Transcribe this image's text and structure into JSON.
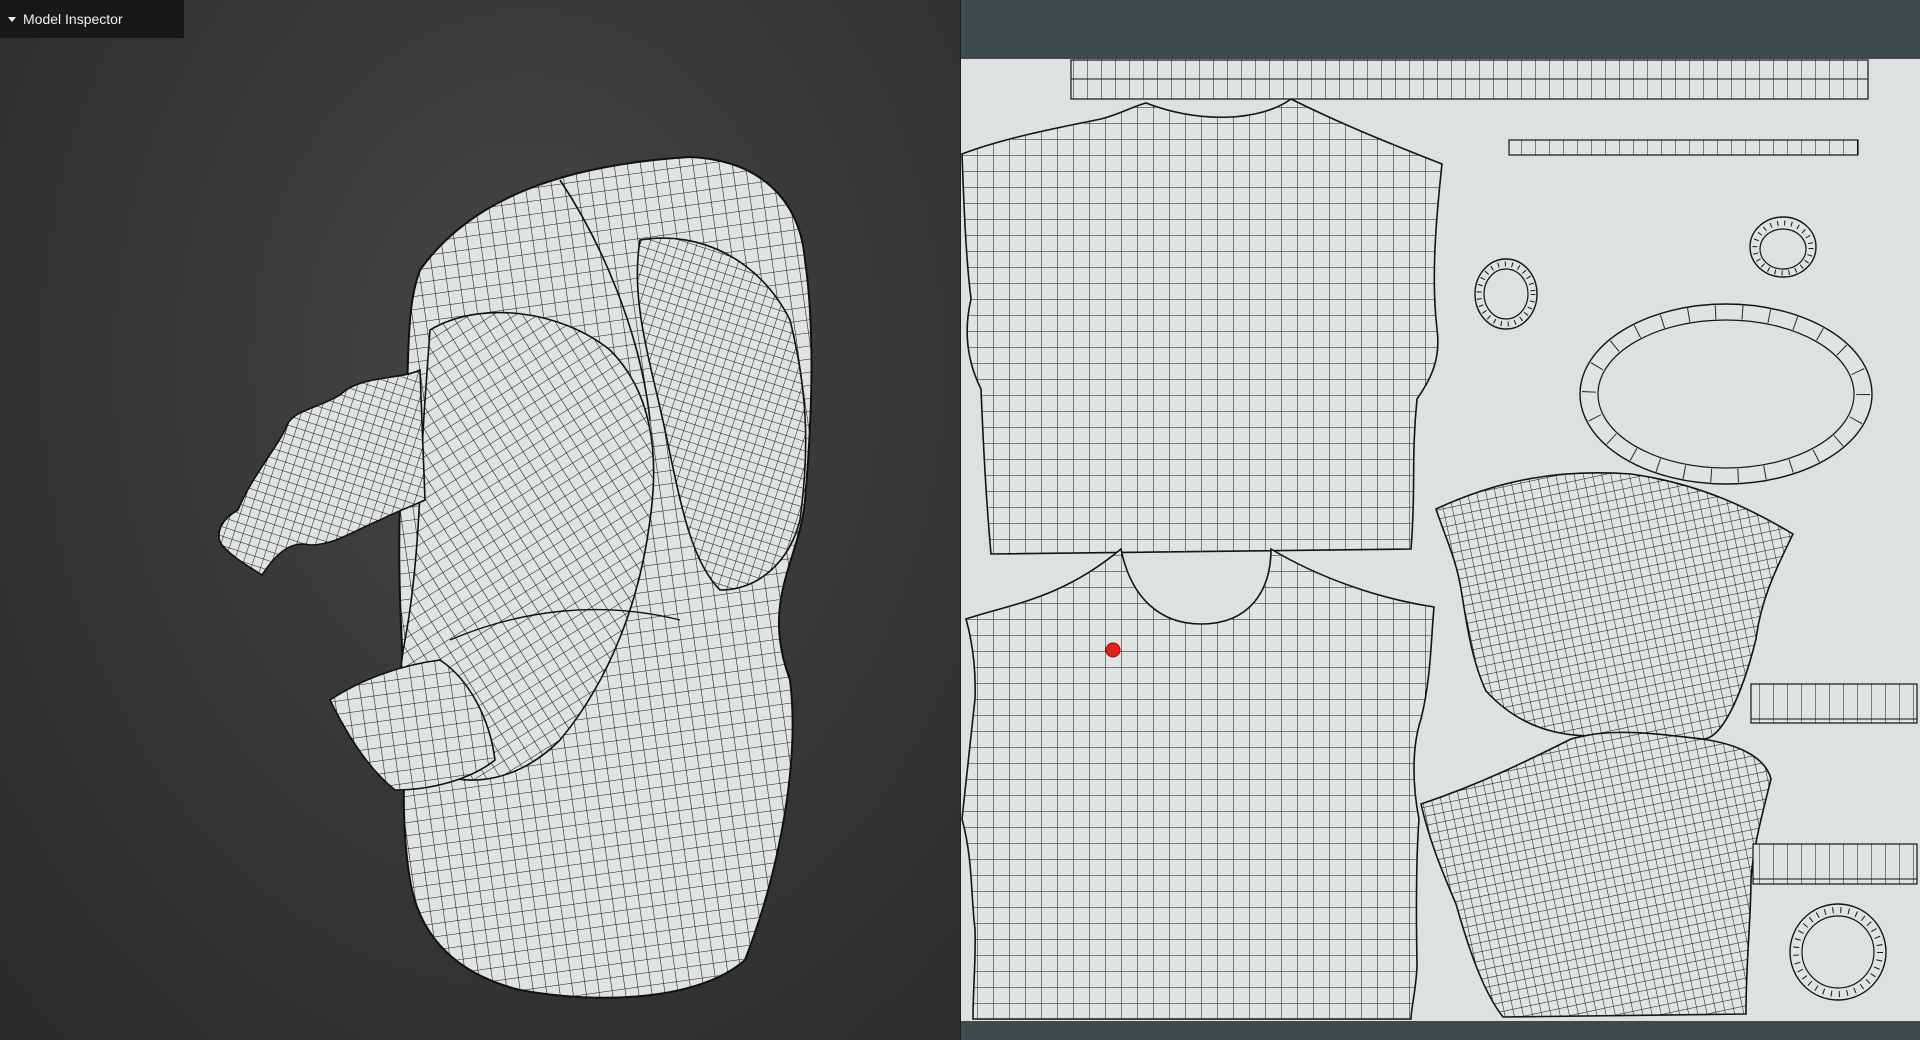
{
  "app": {
    "panel_title": "Model Inspector"
  },
  "icons": {
    "panel_toggle": "caret-down-icon"
  },
  "colors": {
    "viewport_background": "#383838",
    "uv_background": "#dde2e0",
    "uv_frame": "#3f4b4b",
    "mesh_fill": "#dfe4e2",
    "wire": "#111111",
    "selected_vertex": "#e0201c"
  },
  "uv_editor": {
    "islands": [
      "collar-strip-top",
      "collar-strip-thin",
      "shirt-back-panel",
      "shirt-front-panel",
      "cuff-ring-small-left",
      "cuff-ring-small-right",
      "neck-ring-large",
      "sleeve-upper",
      "sleeve-lower",
      "cuff-strip-upper",
      "cuff-strip-lower",
      "cuff-ring-bottom"
    ],
    "selected_vertex_count": 1
  }
}
